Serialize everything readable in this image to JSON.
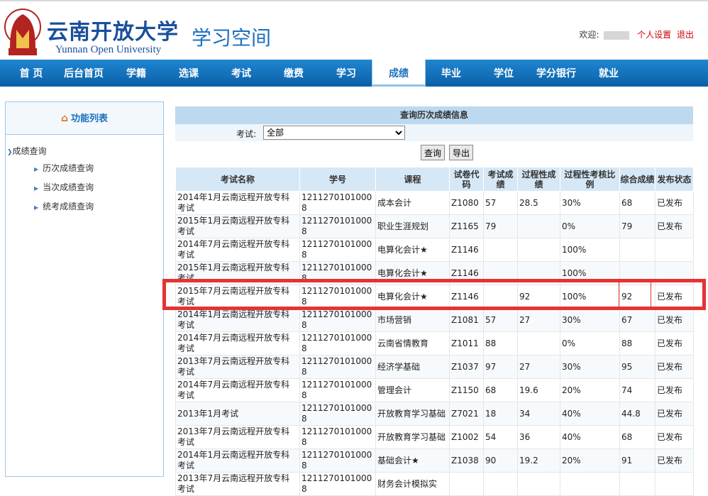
{
  "header": {
    "brand_cn": "云南开放大学",
    "brand_en": "Yunnan Open University",
    "space_title": "学习空间",
    "welcome": "欢迎",
    "settings_link": "个人设置",
    "logout_link": "退出"
  },
  "nav": {
    "items": [
      "首 页",
      "后台首页",
      "学籍",
      "选课",
      "考试",
      "缴费",
      "学习",
      "成绩",
      "毕业",
      "学位",
      "学分银行",
      "就业"
    ],
    "active_index": 7
  },
  "sidebar": {
    "title": "功能列表",
    "group": "成绩查询",
    "items": [
      "历次成绩查询",
      "当次成绩查询",
      "统考成绩查询"
    ]
  },
  "panel": {
    "title": "查询历次成绩信息",
    "exam_label": "考试:",
    "exam_value": "全部",
    "query_button": "查询",
    "export_button": "导出"
  },
  "table": {
    "headers": [
      "考试名称",
      "学号",
      "课程",
      "试卷代码",
      "考试成绩",
      "过程性成绩",
      "过程性考核比例",
      "综合成绩",
      "发布状态"
    ],
    "rows": [
      [
        "2014年1月云南远程开放专科考试",
        "12112701010008",
        "成本会计",
        "Z1080",
        "57",
        "28.5",
        "30%",
        "68",
        "已发布"
      ],
      [
        "2015年1月云南远程开放专科考试",
        "12112701010008",
        "职业生涯规划",
        "Z1165",
        "79",
        "",
        "0%",
        "79",
        "已发布"
      ],
      [
        "2014年7月云南远程开放专科考试",
        "12112701010008",
        "电算化会计★",
        "Z1146",
        "",
        "",
        "100%",
        "",
        ""
      ],
      [
        "2015年1月云南远程开放专科考试",
        "12112701010008",
        "电算化会计★",
        "Z1146",
        "",
        "",
        "100%",
        "",
        ""
      ],
      [
        "2015年7月云南远程开放专科考试",
        "12112701010008",
        "电算化会计★",
        "Z1146",
        "",
        "92",
        "100%",
        "92",
        "已发布"
      ],
      [
        "2014年1月云南远程开放专科考试",
        "12112701010008",
        "市场营销",
        "Z1081",
        "57",
        "27",
        "30%",
        "67",
        "已发布"
      ],
      [
        "2014年7月云南远程开放专科考试",
        "12112701010008",
        "云南省情教育",
        "Z1011",
        "88",
        "",
        "0%",
        "88",
        "已发布"
      ],
      [
        "2013年7月云南远程开放专科考试",
        "12112701010008",
        "经济学基础",
        "Z1037",
        "97",
        "27",
        "30%",
        "95",
        "已发布"
      ],
      [
        "2014年7月云南远程开放专科考试",
        "12112701010008",
        "管理会计",
        "Z1150",
        "68",
        "19.6",
        "20%",
        "74",
        "已发布"
      ],
      [
        "2013年1月考试",
        "12112701010008",
        "开放教育学习基础",
        "Z7021",
        "18",
        "34",
        "40%",
        "44.8",
        "已发布"
      ],
      [
        "2013年7月云南远程开放专科考试",
        "12112701010008",
        "开放教育学习基础",
        "Z1002",
        "54",
        "36",
        "40%",
        "68",
        "已发布"
      ],
      [
        "2014年1月云南远程开放专科考试",
        "12112701010008",
        "基础会计★",
        "Z1038",
        "90",
        "19.2",
        "20%",
        "91",
        "已发布"
      ],
      [
        "2013年7月云南远程开放专科考试",
        "12112701010008",
        "财务会计模拟实",
        "",
        "",
        "",
        "",
        "",
        ""
      ]
    ]
  },
  "colors": {
    "nav_blue": "#0a5fa8",
    "header_blue": "#1a4f9c",
    "highlight_red": "#e53333"
  }
}
